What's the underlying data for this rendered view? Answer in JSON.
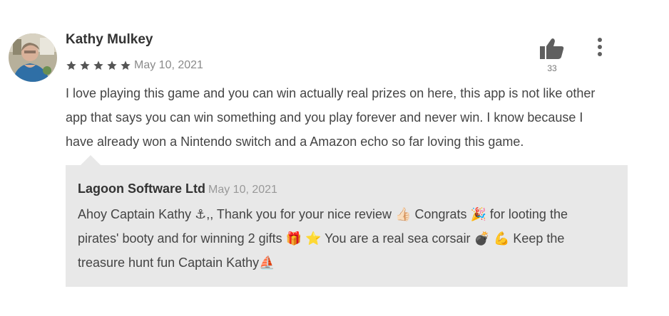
{
  "review": {
    "author": "Kathy Mulkey",
    "rating": 5,
    "rating_max": 5,
    "date": "May 10, 2021",
    "likes": "33",
    "body_lines": [
      "I love playing this game and you can win actually real prizes on here, this app is not like other",
      "app that says you can win something and you play forever and never win. I know because I",
      "have already won a Nintendo switch and a Amazon echo so far loving this game."
    ]
  },
  "reply": {
    "developer": "Lagoon Software Ltd",
    "date": "May 10, 2021",
    "body_lines": [
      "Ahoy Captain Kathy ⚓,, Thank you for your nice review 👍🏻 Congrats 🎉 for looting the",
      "pirates' booty and for winning 2 gifts 🎁 ⭐ You are a real sea corsair 💣 💪 Keep the",
      "treasure hunt fun Captain Kathy⛵"
    ]
  },
  "icons": {
    "avatar": "user-avatar-photo",
    "star": "star-icon",
    "thumb": "thumbs-up-icon",
    "more": "more-vertical-icon"
  },
  "colors": {
    "star": "#555555",
    "thumb": "#5f5f5f",
    "reply_background": "#e8e8e8"
  }
}
